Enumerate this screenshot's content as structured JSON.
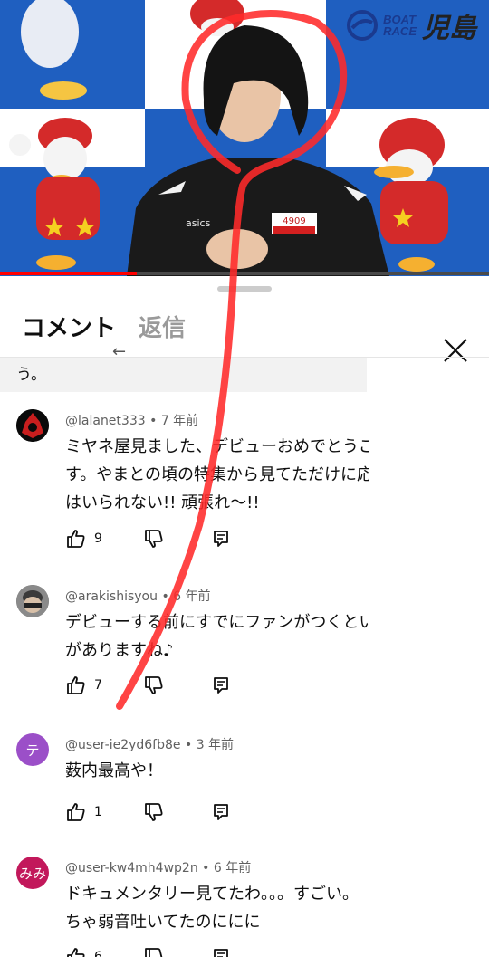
{
  "video": {
    "brand_line1": "BOAT",
    "brand_line2": "RACE",
    "brand_name": "児島",
    "jacket_number": "4909",
    "progress": 0.28,
    "colors": {
      "checker_blue": "#1f5fc0",
      "accent_red": "#ff2020"
    }
  },
  "panel": {
    "tab_comments": "コメント",
    "tab_replies": "返信",
    "back_glyph": "←",
    "context_text": "う。"
  },
  "comments": [
    {
      "author": "@lalanet333",
      "age": "7 年前",
      "lines": [
        "ミヤネ屋見ました、デビューおめでとうご",
        "す。やまとの頃の特集から見てただけに応",
        "はいられない!!  頑張れ〜!!"
      ],
      "likes": "9",
      "avatar_text": ""
    },
    {
      "author": "@arakishisyou",
      "age": "6 年前",
      "lines": [
        "デビューする前にすでにファンがつくとい",
        "がありますね♪"
      ],
      "likes": "7",
      "avatar_text": ""
    },
    {
      "author": "@user-ie2yd6fb8e",
      "age": "3 年前",
      "lines": [
        "薮内最高や！"
      ],
      "likes": "1",
      "avatar_text": "テ"
    },
    {
      "author": "@user-kw4mh4wp2n",
      "age": "6 年前",
      "lines": [
        "ドキュメンタリー見てたわ。。。すごい。",
        "ちゃ弱音吐いてたのににに"
      ],
      "likes": "6",
      "avatar_text": "みみ"
    }
  ],
  "separator": " • "
}
